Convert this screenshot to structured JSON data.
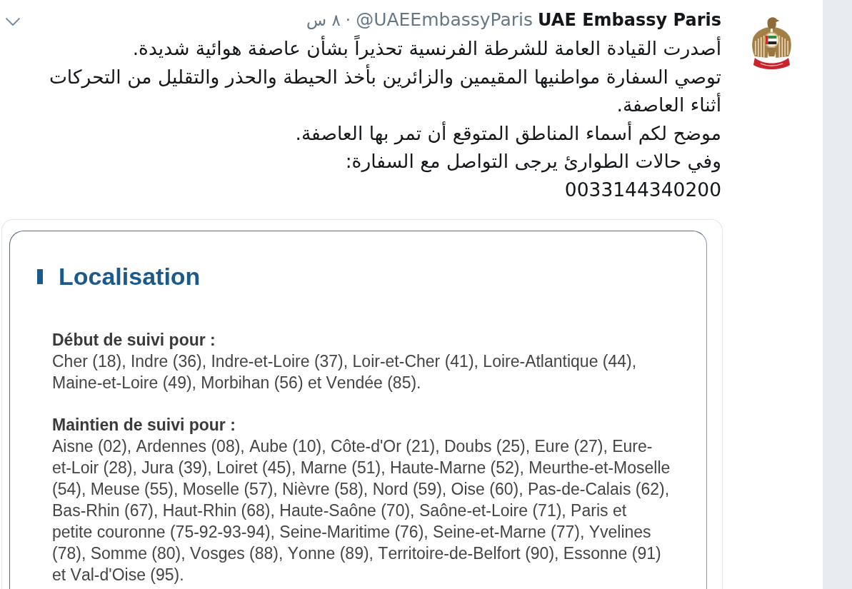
{
  "tweet": {
    "display_name": "UAE Embassy Paris",
    "handle": "@UAEEmbassyParis",
    "separator": "·",
    "time": "٨ س",
    "lines": [
      "أصدرت القيادة العامة للشرطة الفرنسية تحذيراً بشأن عاصفة هوائية شديدة.",
      "توصي السفارة مواطنيها المقيمين والزائرين بأخذ الحيطة والحذر والتقليل من التحركات",
      "أثناء العاصفة.",
      "موضح لكم أسماء المناطق المتوقع أن تمر بها العاصفة.",
      "وفي حالات الطوارئ يرجى التواصل مع السفارة:",
      "0033144340200"
    ]
  },
  "card": {
    "heading": "Localisation",
    "sections": [
      {
        "label": "Début de suivi pour :",
        "text": "Cher (18), Indre (36), Indre-et-Loire (37), Loir-et-Cher (41), Loire-Atlantique (44), Maine-et-Loire (49), Morbihan (56) et Vendée (85)."
      },
      {
        "label": "Maintien de suivi pour :",
        "text": "Aisne (02), Ardennes (08), Aube (10), Côte-d'Or (21), Doubs (25), Eure (27), Eure-et-Loir (28), Jura (39), Loiret (45), Marne (51), Haute-Marne (52), Meurthe-et-Moselle (54), Meuse (55), Moselle (57), Nièvre (58), Nord (59), Oise (60), Pas-de-Calais (62), Bas-Rhin (67), Haut-Rhin (68), Haute-Saône (70), Saône-et-Loire (71), Paris et petite couronne (75-92-93-94), Seine-Maritime (76), Seine-et-Marne (77), Yvelines (78), Somme (80), Vosges (88), Yonne (89), Territoire-de-Belfort (90), Essonne (91) et Val-d'Oise (95)."
      }
    ]
  }
}
